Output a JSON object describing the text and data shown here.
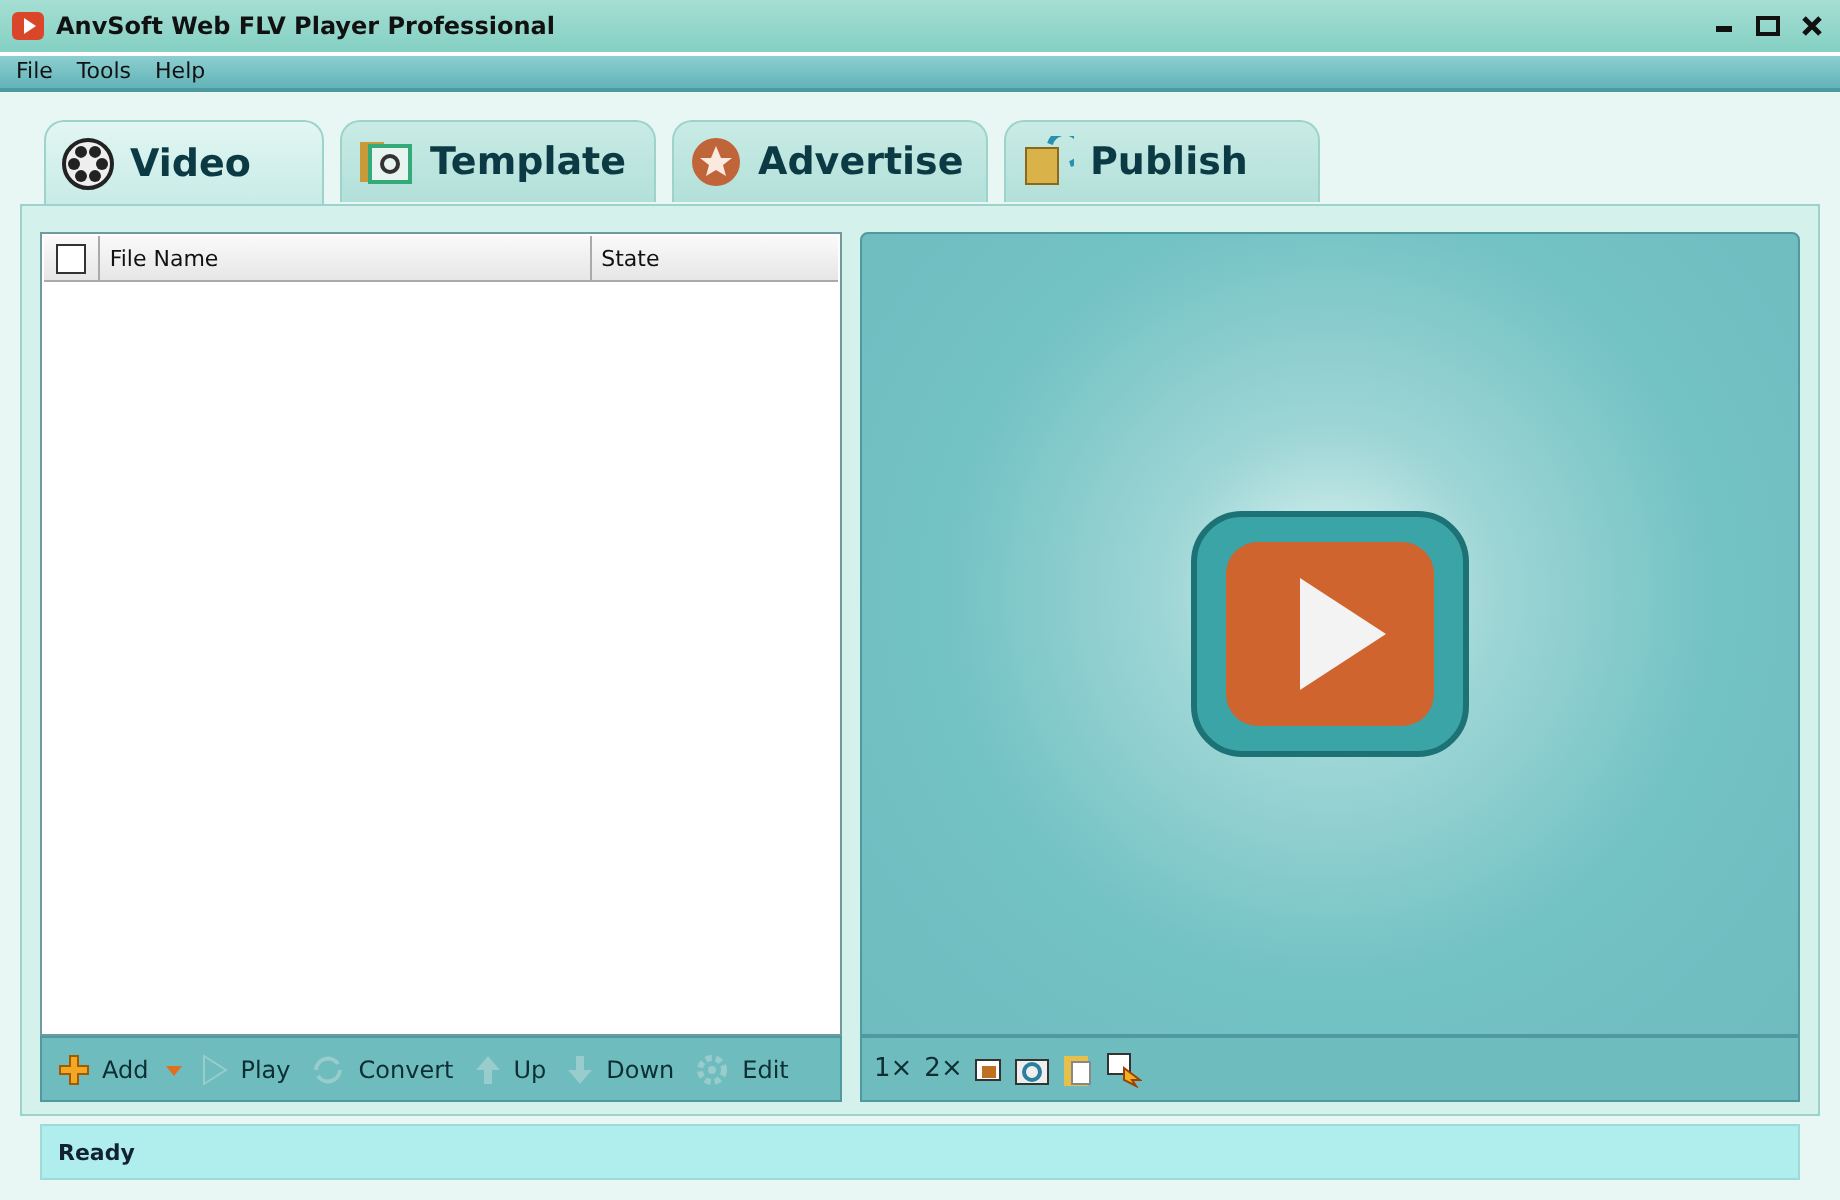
{
  "window": {
    "title": "AnvSoft Web FLV Player Professional"
  },
  "menu": [
    "File",
    "Tools",
    "Help"
  ],
  "tabs": [
    {
      "label": "Video",
      "kind": "video",
      "selected": true
    },
    {
      "label": "Template",
      "kind": "template",
      "selected": false
    },
    {
      "label": "Advertise",
      "kind": "advertise",
      "selected": false
    },
    {
      "label": "Publish",
      "kind": "publish",
      "selected": false
    }
  ],
  "table": {
    "select_all_checked": false,
    "columns": [
      "File Name",
      "State"
    ]
  },
  "toolbar": [
    {
      "label": "Add",
      "kind": "add"
    },
    {
      "label": "Play",
      "kind": "play"
    },
    {
      "label": "Convert",
      "kind": "convert"
    },
    {
      "label": "Up",
      "kind": "up"
    },
    {
      "label": "Down",
      "kind": "down"
    },
    {
      "label": "Edit",
      "kind": "edit"
    }
  ],
  "preview_toolbar": [
    "1×",
    "2×"
  ],
  "status_bar": "Ready"
}
